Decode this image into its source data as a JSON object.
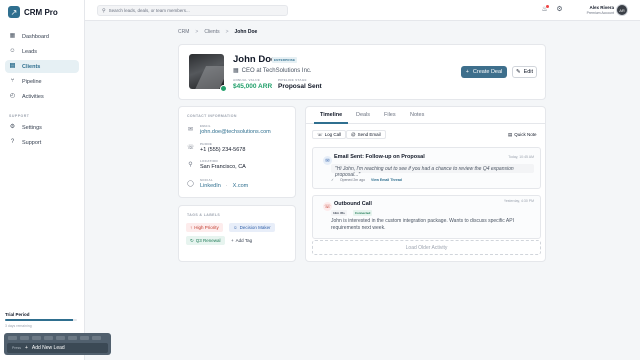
{
  "app": {
    "name": "CRM Pro",
    "logo_glyph": "↗"
  },
  "sidebar": {
    "items": [
      {
        "label": "Dashboard",
        "icon": "▦",
        "icon_name": "dashboard-icon"
      },
      {
        "label": "Leads",
        "icon": "☺",
        "icon_name": "leads-icon"
      },
      {
        "label": "Clients",
        "icon": "▤",
        "icon_name": "clients-icon",
        "active": true
      },
      {
        "label": "Pipeline",
        "icon": "⑂",
        "icon_name": "pipeline-icon"
      },
      {
        "label": "Activities",
        "icon": "◴",
        "icon_name": "activities-icon"
      }
    ],
    "support_heading": "SUPPORT",
    "support_items": [
      {
        "label": "Settings",
        "icon": "⚙",
        "icon_name": "settings-icon"
      },
      {
        "label": "Support",
        "icon": "?",
        "icon_name": "support-icon"
      }
    ],
    "trial": {
      "title": "Trial Period",
      "progress": 0.95,
      "subtitle": "3 days remaining"
    },
    "quick_add": {
      "shortcut": "Press",
      "label": "Add New Lead"
    }
  },
  "topbar": {
    "search_placeholder": "Search leads, deals, or team members...",
    "user": {
      "name": "Alex Rivera",
      "role": "Premium Account",
      "initials": "AR"
    }
  },
  "breadcrumb": {
    "items": [
      "CRM",
      "Clients"
    ],
    "current": "John Doe",
    "separator": ">"
  },
  "profile": {
    "name": "John Doe",
    "badge": "ENTERPRISE",
    "title": "CEO at TechSolutions Inc.",
    "metrics": [
      {
        "label": "ANNUAL VALUE",
        "value": "$45,000 ARR",
        "color": "#22a06b"
      },
      {
        "label": "PIPELINE STAGE",
        "value": "Proposal Sent",
        "color": "#111827"
      }
    ],
    "primary_action": "Create Deal",
    "secondary_action": "Edit"
  },
  "contact": {
    "heading": "CONTACT INFORMATION",
    "email": {
      "label": "EMAIL",
      "value": "john.doe@techsolutions.com"
    },
    "phone": {
      "label": "PHONE",
      "value": "+1 (555) 234-5678"
    },
    "location": {
      "label": "LOCATION",
      "value": "San Francisco, CA"
    },
    "social": {
      "label": "SOCIAL",
      "links": [
        "LinkedIn",
        "X.com"
      ]
    }
  },
  "tags": {
    "heading": "TAGS & LABELS",
    "items": [
      {
        "label": "High Priority",
        "icon": "↑",
        "bg": "#fdecec",
        "fg": "#c0392b"
      },
      {
        "label": "Decision Maker",
        "icon": "☺",
        "bg": "#e8eef9",
        "fg": "#2f5fa8"
      },
      {
        "label": "Q3 Renewal",
        "icon": "↻",
        "bg": "#e7f4ef",
        "fg": "#1d7a55"
      }
    ],
    "add_label": "Add Tag"
  },
  "activity": {
    "tabs": [
      "Timeline",
      "Deals",
      "Files",
      "Notes"
    ],
    "actions": [
      "Log Call",
      "Send Email"
    ],
    "quick_note": "Quick Note",
    "events": [
      {
        "title": "Email Sent: Follow-up on Proposal",
        "time": "Today, 10:45 AM",
        "quote": "\"Hi John, I'm reaching out to see if you had a chance to review the Q4 expansion proposal...\"",
        "status": "Opened 2m ago",
        "link": "View Email Thread"
      },
      {
        "title": "Outbound Call",
        "time": "Yesterday, 4:30 PM",
        "duration": "12m 45s",
        "outcome": "Connected",
        "body": "John is interested in the custom integration package. Wants to discuss specific API requirements next week."
      }
    ],
    "load_more": "Load Older Activity"
  }
}
